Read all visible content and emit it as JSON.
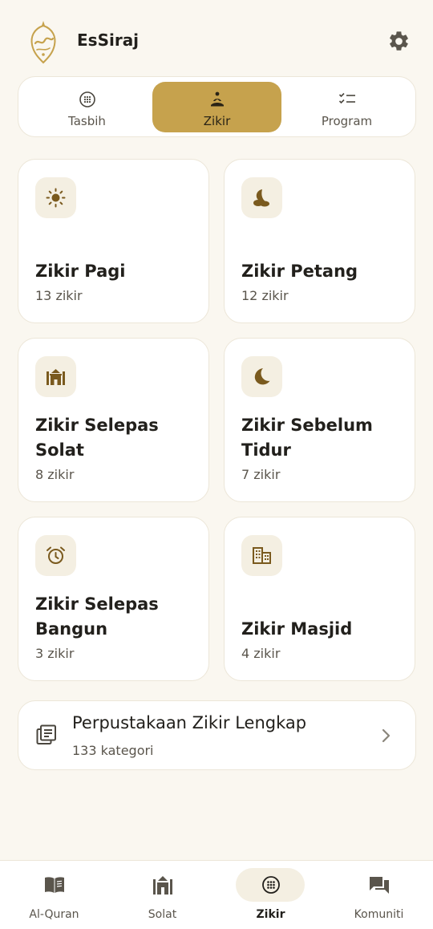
{
  "app": {
    "title": "EsSiraj"
  },
  "segments": [
    {
      "label": "Tasbih",
      "icon": "tasbih-icon",
      "active": false
    },
    {
      "label": "Zikir",
      "icon": "prayer-person-icon",
      "active": true
    },
    {
      "label": "Program",
      "icon": "checklist-icon",
      "active": false
    }
  ],
  "cards": [
    {
      "title": "Zikir Pagi",
      "count": "13 zikir",
      "icon": "sun-icon"
    },
    {
      "title": "Zikir Petang",
      "count": "12 zikir",
      "icon": "evening-moon-icon"
    },
    {
      "title": "Zikir Selepas Solat",
      "count": "8 zikir",
      "icon": "mosque-icon"
    },
    {
      "title": "Zikir Sebelum Tidur",
      "count": "7 zikir",
      "icon": "crescent-moon-icon"
    },
    {
      "title": "Zikir Selepas Bangun",
      "count": "3 zikir",
      "icon": "alarm-clock-icon"
    },
    {
      "title": "Zikir Masjid",
      "count": "4 zikir",
      "icon": "building-icon"
    }
  ],
  "library": {
    "title": "Perpustakaan Zikir Lengkap",
    "subtitle": "133 kategori"
  },
  "bottom_nav": [
    {
      "label": "Al-Quran",
      "icon": "book-icon",
      "active": false
    },
    {
      "label": "Solat",
      "icon": "mosque-icon",
      "active": false
    },
    {
      "label": "Zikir",
      "icon": "tasbih-icon",
      "active": true
    },
    {
      "label": "Komuniti",
      "icon": "chat-icon",
      "active": false
    }
  ],
  "colors": {
    "background": "#faf7f0",
    "accent": "#c6a24d",
    "icon_brown": "#7a5a1e",
    "icon_tile": "#f4efe2"
  }
}
